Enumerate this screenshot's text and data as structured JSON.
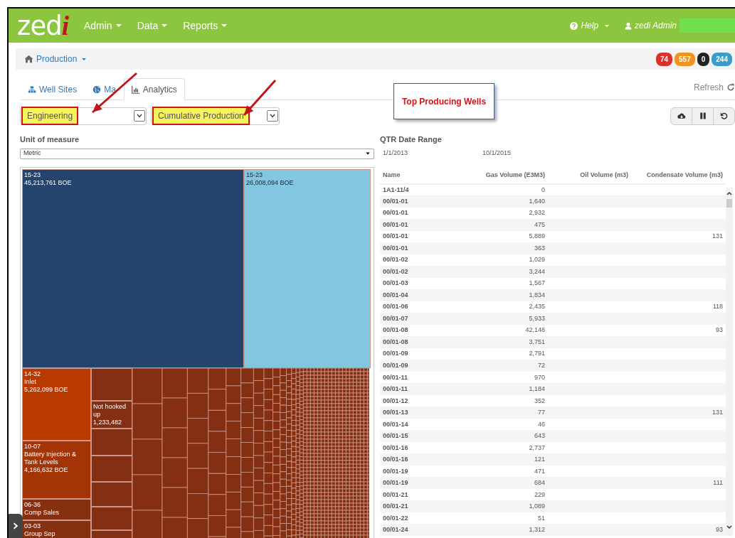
{
  "navbar": {
    "logo": "zedi",
    "menus": [
      {
        "label": "Admin"
      },
      {
        "label": "Data"
      },
      {
        "label": "Reports"
      }
    ],
    "help": "Help",
    "user": "zedi Admin"
  },
  "breadcrumb": {
    "label": "Production"
  },
  "badges": [
    {
      "text": "74",
      "color": "#d9312b"
    },
    {
      "text": "557",
      "color": "#f0941e"
    },
    {
      "text": "0",
      "color": "#222222"
    },
    {
      "text": "244",
      "color": "#3a9cc8"
    }
  ],
  "tabs": [
    {
      "label": "Well Sites",
      "selected": false
    },
    {
      "label": "Ma",
      "selected": false
    },
    {
      "label": "Analytics",
      "selected": true
    }
  ],
  "callout": "Top Producing Wells",
  "refresh": "Refresh",
  "selects": [
    {
      "value": "Engineering"
    },
    {
      "value": "Cumulative Production"
    }
  ],
  "unit": {
    "label": "Unit of measure",
    "value": "Metric"
  },
  "date_range": {
    "label": "QTR Date Range",
    "start": "1/1/2013",
    "end": "10/1/2015"
  },
  "treemap": {
    "top": [
      {
        "lines": [
          "15-23",
          "45,213,761 BOE"
        ],
        "color": "#25446d"
      },
      {
        "lines": [
          "15-23",
          "26,008,094 BOE"
        ],
        "color": "#82c7df"
      }
    ],
    "left_column": [
      {
        "lines": [
          "14-32",
          "Inlet",
          "5,262,099 BOE"
        ],
        "color": "#b83a00"
      },
      {
        "lines": [
          "10-07",
          "Battery Injection & Tank Levels",
          "4,166,632 BOE"
        ],
        "color": "#a33406"
      },
      {
        "lines": [
          "06-36",
          "Comp Sales"
        ],
        "color": "#86300f"
      },
      {
        "lines": [
          "03-03",
          "Group Sep"
        ],
        "color": "#86300f"
      }
    ],
    "second_column": {
      "lines": [
        "Not hooked up",
        "1,233,482"
      ],
      "color": "#842e12"
    }
  },
  "table": {
    "columns": [
      "Name",
      "Gas Volume (E3M3)",
      "Oil Volume (m3)",
      "Condensate Volume (m3)"
    ],
    "rows": [
      [
        "1A1-11/4",
        "0",
        "",
        ""
      ],
      [
        "00/01-01",
        "1,640",
        "",
        ""
      ],
      [
        "00/01-01",
        "2,932",
        "",
        ""
      ],
      [
        "00/01-01",
        "475",
        "",
        ""
      ],
      [
        "00/01-01",
        "5,889",
        "",
        "131"
      ],
      [
        "00/01-01",
        "363",
        "",
        ""
      ],
      [
        "00/01-02",
        "1,029",
        "",
        ""
      ],
      [
        "00/01-02",
        "3,244",
        "",
        ""
      ],
      [
        "00/01-03",
        "1,567",
        "",
        ""
      ],
      [
        "00/01-04",
        "1,834",
        "",
        ""
      ],
      [
        "00/01-06",
        "2,435",
        "",
        "118"
      ],
      [
        "00/01-07",
        "5,933",
        "",
        ""
      ],
      [
        "00/01-08",
        "42,148",
        "",
        "93"
      ],
      [
        "00/01-08",
        "3,751",
        "",
        ""
      ],
      [
        "00/01-09",
        "2,791",
        "",
        ""
      ],
      [
        "00/01-09",
        "72",
        "",
        ""
      ],
      [
        "00/01-11",
        "970",
        "",
        ""
      ],
      [
        "00/01-11",
        "1,184",
        "",
        ""
      ],
      [
        "00/01-12",
        "352",
        "",
        ""
      ],
      [
        "00/01-13",
        "77",
        "",
        "131"
      ],
      [
        "00/01-14",
        "46",
        "",
        ""
      ],
      [
        "00/01-15",
        "643",
        "",
        ""
      ],
      [
        "00/01-16",
        "2,737",
        "",
        ""
      ],
      [
        "00/01-16",
        "121",
        "",
        ""
      ],
      [
        "00/01-19",
        "471",
        "",
        ""
      ],
      [
        "00/01-19",
        "684",
        "",
        "111"
      ],
      [
        "00/01-21",
        "229",
        "",
        ""
      ],
      [
        "00/01-21",
        "1,089",
        "",
        ""
      ],
      [
        "00/01-22",
        "51",
        "",
        ""
      ],
      [
        "00/01-24",
        "1,312",
        "",
        "93"
      ]
    ]
  }
}
